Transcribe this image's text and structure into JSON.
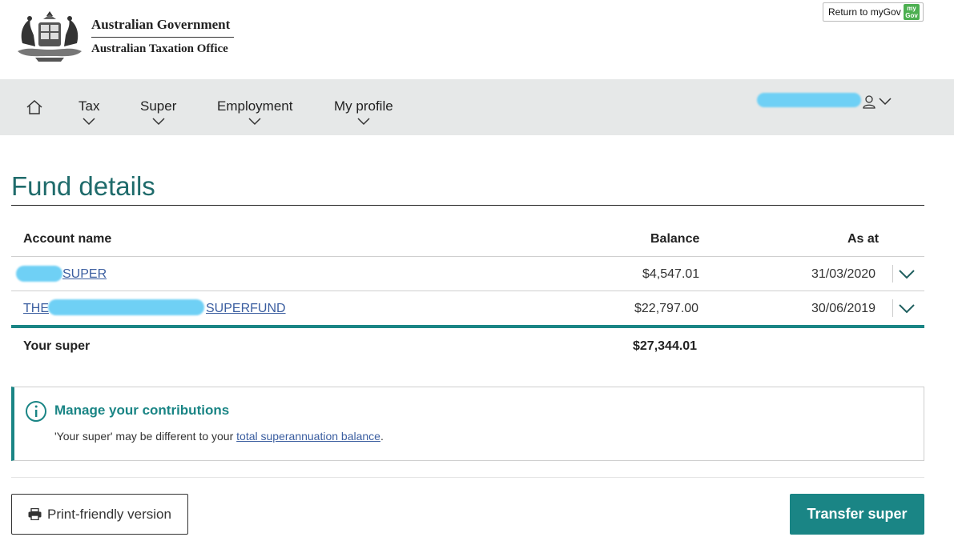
{
  "header": {
    "gov_line1": "Australian Government",
    "gov_line2": "Australian Taxation Office",
    "return_label": "Return to myGov",
    "mygov_logo_text_top": "my",
    "mygov_logo_text_bottom": "Gov"
  },
  "nav": {
    "items": [
      {
        "label": "Tax"
      },
      {
        "label": "Super"
      },
      {
        "label": "Employment"
      },
      {
        "label": "My profile"
      }
    ]
  },
  "page": {
    "title": "Fund details"
  },
  "table": {
    "headers": {
      "account": "Account name",
      "balance": "Balance",
      "as_at": "As at"
    },
    "rows": [
      {
        "account_prefix": "",
        "account_suffix": "SUPER",
        "balance": "$4,547.01",
        "as_at": "31/03/2020"
      },
      {
        "account_prefix": "THE",
        "account_suffix": "SUPERFUND",
        "balance": "$22,797.00",
        "as_at": "30/06/2019"
      }
    ],
    "total": {
      "label": "Your super",
      "balance": "$27,344.01"
    }
  },
  "info": {
    "title": "Manage your contributions",
    "text_before": "'Your super' may be different to your ",
    "link": "total superannuation balance",
    "text_after": "."
  },
  "actions": {
    "print_label": "Print-friendly version",
    "transfer_label": "Transfer super"
  },
  "colors": {
    "accent": "#1a8585",
    "title": "#1f6b6b",
    "nav_bg": "#e6e8e8",
    "link": "#3b5ea0"
  }
}
